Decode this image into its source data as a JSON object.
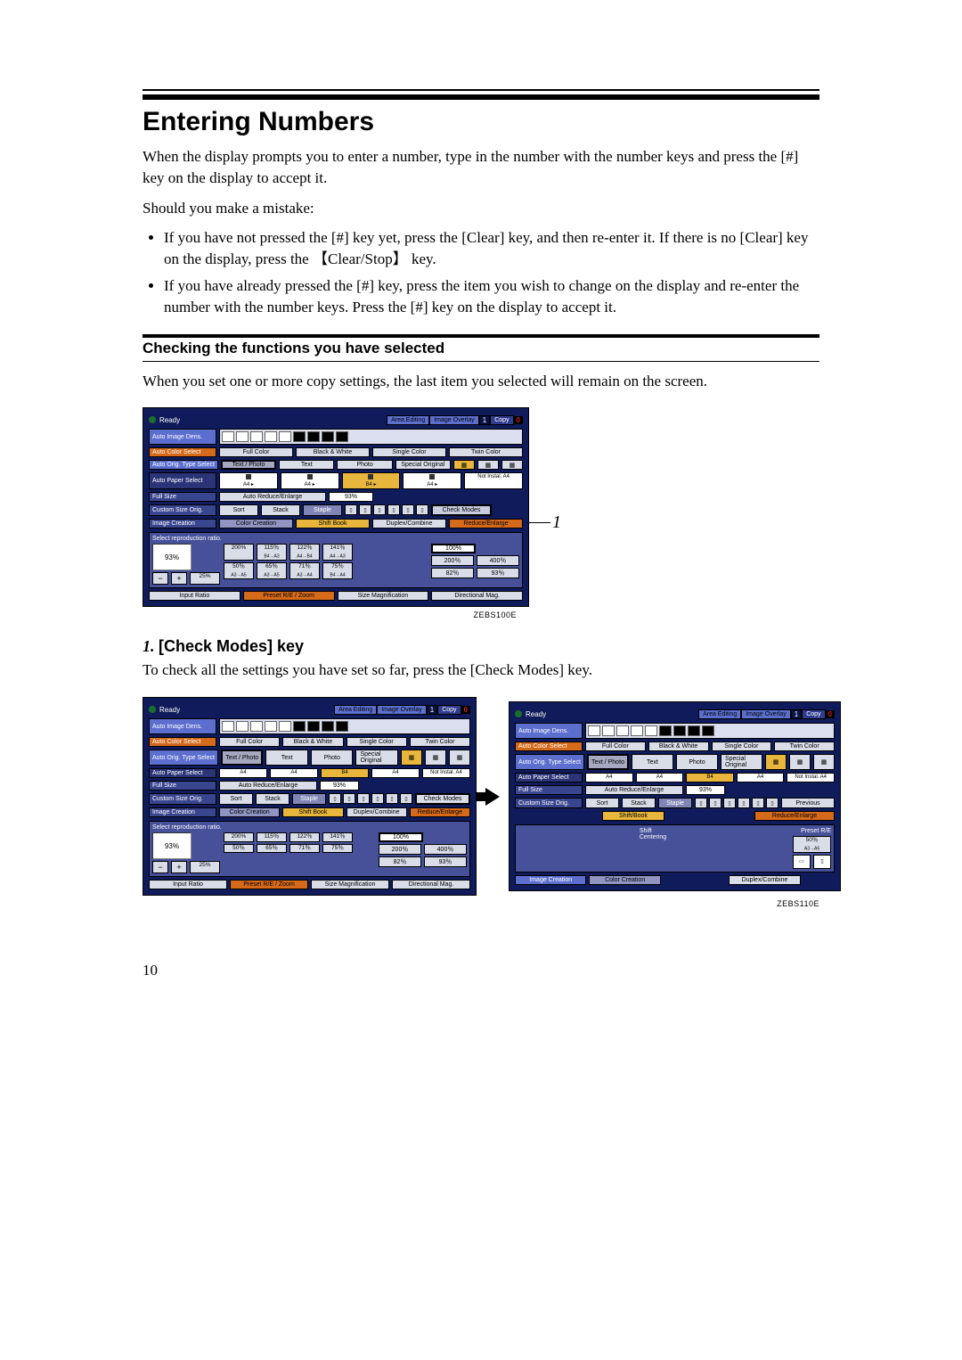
{
  "heading": "Entering Numbers",
  "intro": "When the display prompts you to enter a number, type in the number with the number keys and press the [#] key on the display to accept it.",
  "mistake_lead": "Should you make a mistake:",
  "bullets": [
    "If you have not pressed the [#] key yet, press the [Clear] key, and then re-enter it. If there is no [Clear] key on the display, press the 【Clear/Stop】 key.",
    "If you have already pressed the [#] key, press the item you wish to change on the display and re-enter the number with the number keys. Press the [#] key on the display to accept it."
  ],
  "subheading": "Checking the functions you have selected",
  "sub_body": "When you set one or more copy settings, the last item you selected will remain on the screen.",
  "callout_label": "1",
  "fig1_ref": "ZEBS100E",
  "fig2_ref": "ZEBS110E",
  "step1_num": "1.",
  "step1_label": "[Check Modes]",
  "step1_tail": " key",
  "step1_body": "To check all the settings you have set so far, press the [Check Modes] key.",
  "page_number": "10",
  "panel": {
    "ready": "Ready",
    "area_editing": "Area Editing",
    "image_overlay": "Image Overlay",
    "jobs": "1",
    "copy": "Copy",
    "copy_n": "0",
    "row1_label": "Auto Image Dens.",
    "row_color": {
      "label": "Auto Color Select",
      "opts": [
        "Full Color",
        "Black & White",
        "Single Color",
        "Twin Color"
      ]
    },
    "row_orig": {
      "label": "Auto Orig. Type Select",
      "opts": [
        "Text / Photo",
        "Text",
        "Photo",
        "Special Original"
      ]
    },
    "row_paper": {
      "label": "Auto Paper Select",
      "opts": [
        "A4",
        "A4",
        "B4",
        "A4",
        "Not Instal.\nA4"
      ]
    },
    "row_fs": {
      "label": "Full Size",
      "opt": "Auto Reduce/Enlarge",
      "val": "93%"
    },
    "row_cs": {
      "label": "Custom Size Orig.",
      "opts": [
        "Sort",
        "Stack",
        "Staple"
      ],
      "check": "Check Modes"
    },
    "row_img": {
      "a": "Image Creation",
      "b": "Color Creation",
      "c": "Shift Book",
      "d": "Duplex/Combine",
      "e": "Reduce/Enlarge"
    },
    "select_ratio": "Select reproduction ratio.",
    "zoom_val": "93%",
    "zoom_big": "200%",
    "ratios_top": [
      "100%",
      "200％",
      "400％"
    ],
    "ratios_bot": [
      "82％",
      "93％"
    ],
    "mini_top": [
      "115％",
      "122％",
      "141％"
    ],
    "mini_top_sub": [
      "B4→A3",
      "A4→B4",
      "A4→A3"
    ],
    "mini_bot": [
      "50％",
      "65％",
      "71％",
      "75％"
    ],
    "mini_bot_sub": [
      "A3→A5",
      "A3→A5",
      "A3→A4",
      "B4→A4"
    ],
    "left_pct": "25%",
    "foot": [
      "Input Ratio",
      "Preset R/E / Zoom",
      "Size Magnification",
      "Directional Mag."
    ]
  },
  "shift_panel": {
    "section_title": "Shift/Book",
    "items": [
      "Shift",
      "Centering"
    ],
    "right_label": "Preset R/E",
    "right_pcts": [
      "50％",
      "A3→A5"
    ],
    "foot_a": "Image Creation",
    "foot_b": "Color Creation",
    "foot_c": "Duplex/Combine",
    "previous": "Previous"
  }
}
